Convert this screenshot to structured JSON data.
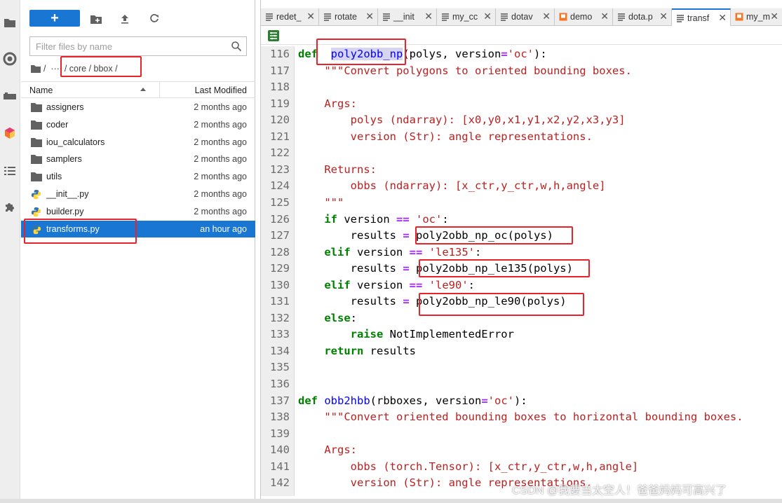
{
  "activity_bar": {
    "icons": [
      "folder-icon",
      "running-icon",
      "commands-icon",
      "palette-icon",
      "toc-icon",
      "extension-icon"
    ]
  },
  "file_browser": {
    "new_label": "+",
    "filter_placeholder": "Filter files by name",
    "breadcrumb": "/  ···  / core / bbox /",
    "columns": {
      "name": "Name",
      "modified": "Last Modified"
    },
    "items": [
      {
        "name": "assigners",
        "modified": "2 months ago",
        "type": "folder"
      },
      {
        "name": "coder",
        "modified": "2 months ago",
        "type": "folder"
      },
      {
        "name": "iou_calculators",
        "modified": "2 months ago",
        "type": "folder"
      },
      {
        "name": "samplers",
        "modified": "2 months ago",
        "type": "folder"
      },
      {
        "name": "utils",
        "modified": "2 months ago",
        "type": "folder"
      },
      {
        "name": "__init__.py",
        "modified": "2 months ago",
        "type": "python"
      },
      {
        "name": "builder.py",
        "modified": "2 months ago",
        "type": "python"
      },
      {
        "name": "transforms.py",
        "modified": "an hour ago",
        "type": "python",
        "selected": true
      }
    ]
  },
  "editor": {
    "tabs": [
      {
        "label": "redet_",
        "type": "text"
      },
      {
        "label": "rotate",
        "type": "text"
      },
      {
        "label": "__init",
        "type": "text"
      },
      {
        "label": "my_cc",
        "type": "text"
      },
      {
        "label": "dotav",
        "type": "text"
      },
      {
        "label": "demo",
        "type": "notebook"
      },
      {
        "label": "dota.p",
        "type": "text"
      },
      {
        "label": "transf",
        "type": "text",
        "active": true
      },
      {
        "label": "my_m",
        "type": "notebook"
      }
    ],
    "lines": [
      {
        "n": "116",
        "tokens": [
          [
            "kw",
            "def"
          ],
          [
            "",
            "  "
          ],
          [
            "fnsel",
            "poly2obb_np"
          ],
          [
            "",
            "(polys, version"
          ],
          [
            "op",
            "="
          ],
          [
            "str",
            "'oc'"
          ],
          [
            "",
            "):"
          ]
        ]
      },
      {
        "n": "117",
        "tokens": [
          [
            "",
            "    "
          ],
          [
            "str",
            "\"\"\"Convert polygons to oriented bounding boxes."
          ]
        ]
      },
      {
        "n": "118",
        "tokens": []
      },
      {
        "n": "119",
        "tokens": [
          [
            "",
            "    "
          ],
          [
            "str",
            "Args:"
          ]
        ]
      },
      {
        "n": "120",
        "tokens": [
          [
            "",
            "        "
          ],
          [
            "str",
            "polys (ndarray): [x0,y0,x1,y1,x2,y2,x3,y3]"
          ]
        ]
      },
      {
        "n": "121",
        "tokens": [
          [
            "",
            "        "
          ],
          [
            "str",
            "version (Str): angle representations."
          ]
        ]
      },
      {
        "n": "122",
        "tokens": []
      },
      {
        "n": "123",
        "tokens": [
          [
            "",
            "    "
          ],
          [
            "str",
            "Returns:"
          ]
        ]
      },
      {
        "n": "124",
        "tokens": [
          [
            "",
            "        "
          ],
          [
            "str",
            "obbs (ndarray): [x_ctr,y_ctr,w,h,angle]"
          ]
        ]
      },
      {
        "n": "125",
        "tokens": [
          [
            "",
            "    "
          ],
          [
            "str",
            "\"\"\""
          ]
        ]
      },
      {
        "n": "126",
        "tokens": [
          [
            "",
            "    "
          ],
          [
            "kw",
            "if"
          ],
          [
            "",
            " version "
          ],
          [
            "op",
            "=="
          ],
          [
            "",
            " "
          ],
          [
            "str",
            "'oc'"
          ],
          [
            "",
            ":"
          ]
        ]
      },
      {
        "n": "127",
        "tokens": [
          [
            "",
            "        results "
          ],
          [
            "op",
            "="
          ],
          [
            "",
            " poly2obb_np_oc(polys)"
          ]
        ]
      },
      {
        "n": "128",
        "tokens": [
          [
            "",
            "    "
          ],
          [
            "kw",
            "elif"
          ],
          [
            "",
            " version "
          ],
          [
            "op",
            "=="
          ],
          [
            "",
            " "
          ],
          [
            "str",
            "'le135'"
          ],
          [
            "",
            ":"
          ]
        ]
      },
      {
        "n": "129",
        "tokens": [
          [
            "",
            "        results "
          ],
          [
            "op",
            "="
          ],
          [
            "",
            " poly2obb_np_le135(polys)"
          ]
        ]
      },
      {
        "n": "130",
        "tokens": [
          [
            "",
            "    "
          ],
          [
            "kw",
            "elif"
          ],
          [
            "",
            " version "
          ],
          [
            "op",
            "=="
          ],
          [
            "",
            " "
          ],
          [
            "str",
            "'le90'"
          ],
          [
            "",
            ":"
          ]
        ]
      },
      {
        "n": "131",
        "tokens": [
          [
            "",
            "        results "
          ],
          [
            "op",
            "="
          ],
          [
            "",
            " poly2obb_np_le90(polys)"
          ]
        ]
      },
      {
        "n": "132",
        "tokens": [
          [
            "",
            "    "
          ],
          [
            "kw",
            "else"
          ],
          [
            "",
            ":"
          ]
        ]
      },
      {
        "n": "133",
        "tokens": [
          [
            "",
            "        "
          ],
          [
            "kw",
            "raise"
          ],
          [
            "",
            " NotImplementedError"
          ]
        ]
      },
      {
        "n": "134",
        "tokens": [
          [
            "",
            "    "
          ],
          [
            "kw",
            "return"
          ],
          [
            "",
            " results"
          ]
        ]
      },
      {
        "n": "135",
        "tokens": []
      },
      {
        "n": "136",
        "tokens": []
      },
      {
        "n": "137",
        "tokens": [
          [
            "kw",
            "def"
          ],
          [
            "",
            " "
          ],
          [
            "fn",
            "obb2hbb"
          ],
          [
            "",
            "(rbboxes, version"
          ],
          [
            "op",
            "="
          ],
          [
            "str",
            "'oc'"
          ],
          [
            "",
            "):"
          ]
        ]
      },
      {
        "n": "138",
        "tokens": [
          [
            "",
            "    "
          ],
          [
            "str",
            "\"\"\"Convert oriented bounding boxes to horizontal bounding boxes."
          ]
        ]
      },
      {
        "n": "139",
        "tokens": []
      },
      {
        "n": "140",
        "tokens": [
          [
            "",
            "    "
          ],
          [
            "str",
            "Args:"
          ]
        ]
      },
      {
        "n": "141",
        "tokens": [
          [
            "",
            "        "
          ],
          [
            "str",
            "obbs (torch.Tensor): [x_ctr,y_ctr,w,h,angle]"
          ]
        ]
      },
      {
        "n": "142",
        "tokens": [
          [
            "",
            "        "
          ],
          [
            "str",
            "version (Str): angle representations."
          ]
        ]
      }
    ]
  },
  "watermark": "CSDN @我要当太空人！爸爸妈妈可高兴了",
  "colors": {
    "accent": "#1976d2",
    "highlight": "#e8232c",
    "keyword": "#008000",
    "string": "#ba2121",
    "function": "#0000ff"
  }
}
